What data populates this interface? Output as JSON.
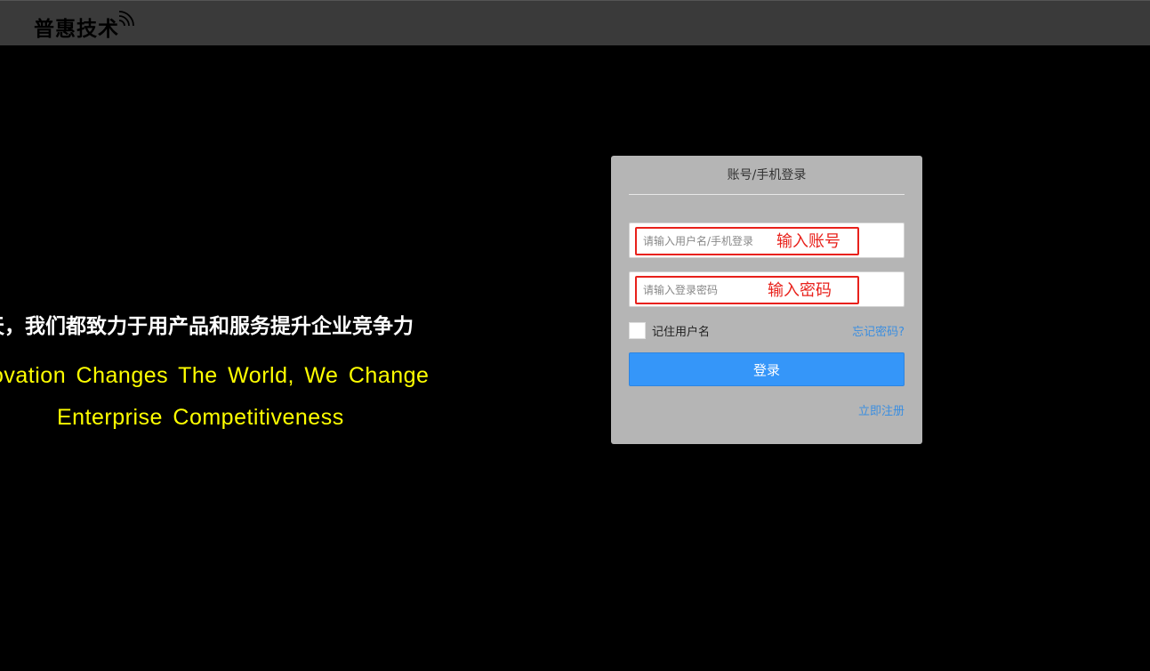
{
  "header": {
    "logo_text": "普惠技术",
    "logo_icon": "wifi-signal-icon",
    "background": "#3a3a3a"
  },
  "hero": {
    "slogan_cn": "天，我们都致力于用产品和服务提升企业竞争力",
    "slogan_en_line1": "ovation Changes The World, We Change",
    "slogan_en_line2": "Enterprise Competitiveness",
    "slogan_en_color": "#ffff00"
  },
  "login": {
    "title": "账号/手机登录",
    "username_placeholder": "请输入用户名/手机登录",
    "username_annotation": "输入账号",
    "password_placeholder": "请输入登录密码",
    "password_annotation": "输入密码",
    "remember_label": "记住用户名",
    "forgot_link": "忘记密码?",
    "submit_label": "登录",
    "register_link": "立即注册",
    "accent_color": "#3596f9",
    "annotation_color": "#e8211b"
  }
}
